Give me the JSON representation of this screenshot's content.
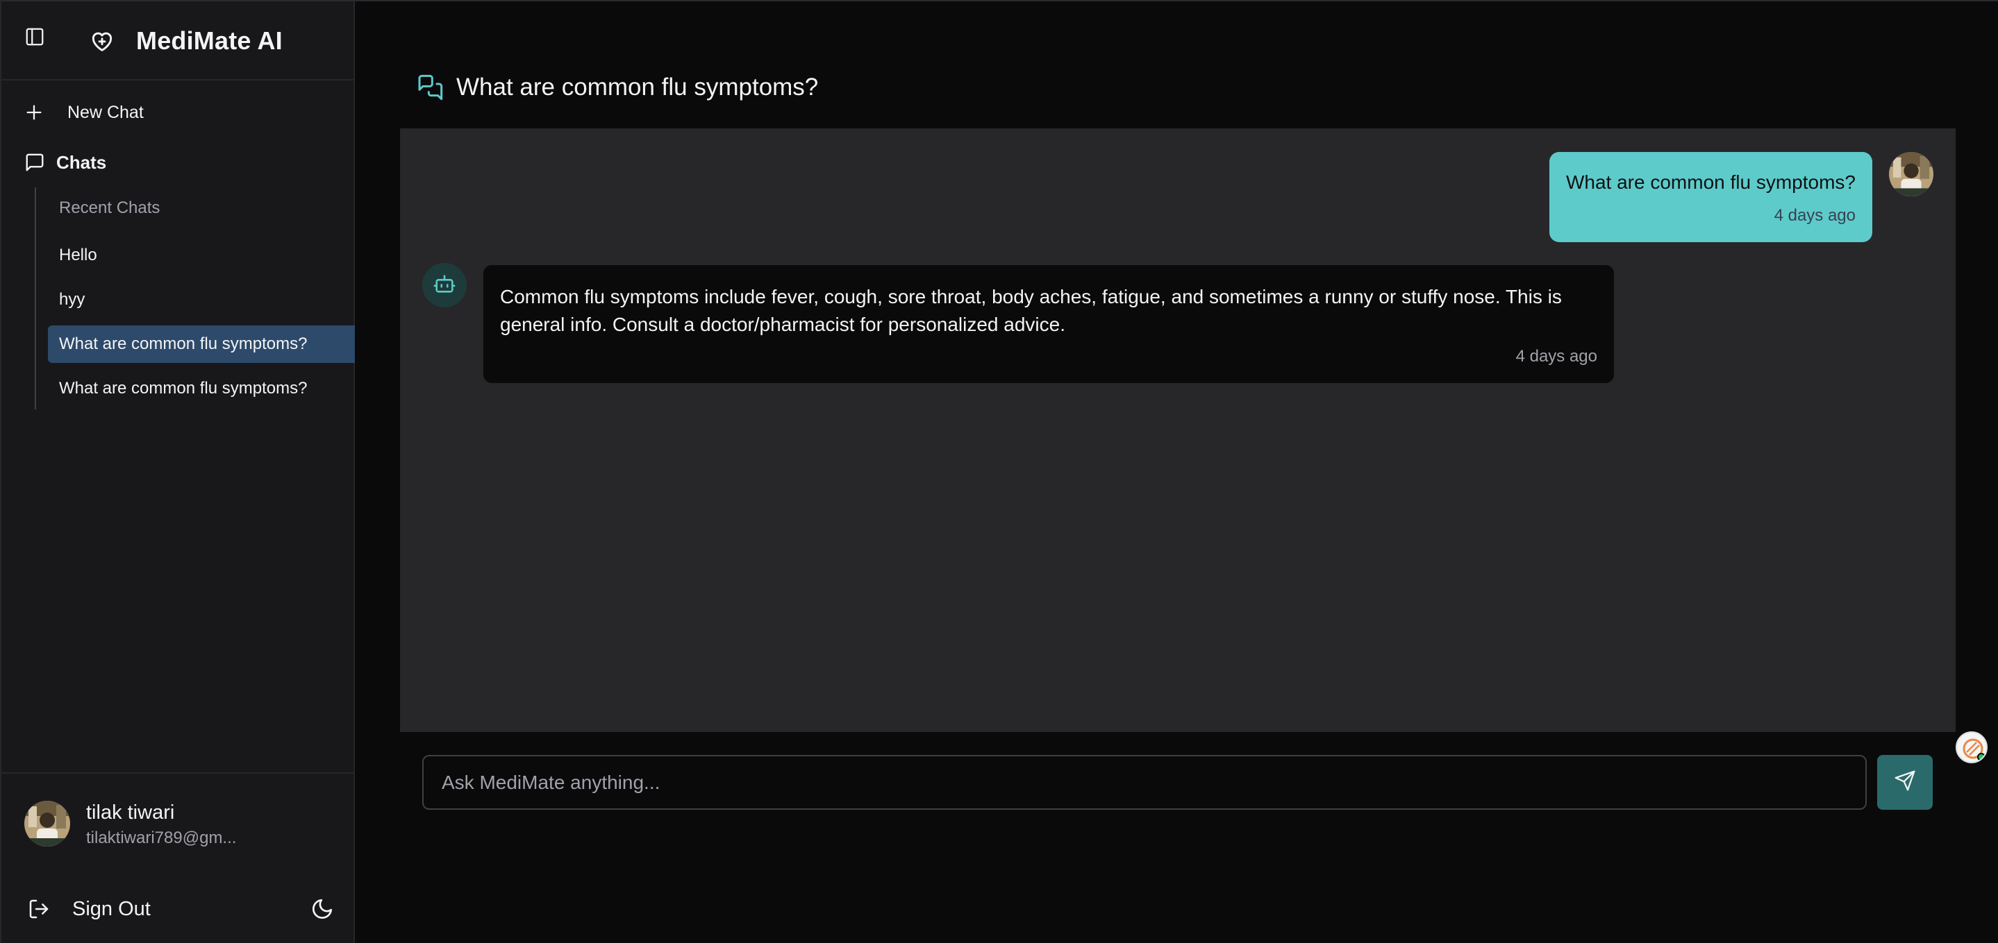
{
  "app": {
    "name": "MediMate AI"
  },
  "sidebar": {
    "new_chat_label": "New Chat",
    "chats_label": "Chats",
    "recent_label": "Recent Chats",
    "items": [
      {
        "label": "Hello",
        "active": false
      },
      {
        "label": "hyy",
        "active": false
      },
      {
        "label": "What are common flu symptoms?",
        "active": true
      },
      {
        "label": "What are common flu symptoms?",
        "active": false
      }
    ],
    "user": {
      "name": "tilak tiwari",
      "email": "tilaktiwari789@gm..."
    },
    "sign_out_label": "Sign Out"
  },
  "main": {
    "title": "What are common flu symptoms?",
    "messages": [
      {
        "role": "user",
        "text": "What are common flu symptoms?",
        "time": "4 days ago"
      },
      {
        "role": "assistant",
        "text": "Common flu symptoms include fever, cough, sore throat, body aches, fatigue, and sometimes a runny or stuffy nose. This is general info. Consult a doctor/pharmacist for personalized advice.",
        "time": "4 days ago"
      }
    ],
    "composer": {
      "placeholder": "Ask MediMate anything..."
    }
  },
  "icons": {
    "sidebar_toggle": "sidebar-toggle-icon",
    "brand": "heart-plus-icon",
    "new_chat": "plus-icon",
    "chats": "message-square-icon",
    "title": "messages-icon",
    "bot": "bot-icon",
    "send": "send-icon",
    "sign_out": "log-out-icon",
    "theme": "moon-icon"
  },
  "colors": {
    "accent": "#5ecbcb",
    "active_item": "#2d4a6a",
    "send_button": "#2a6a6a",
    "sidebar_bg": "#18181b",
    "chat_area_bg": "#27272a",
    "online_status": "#22c55e"
  }
}
